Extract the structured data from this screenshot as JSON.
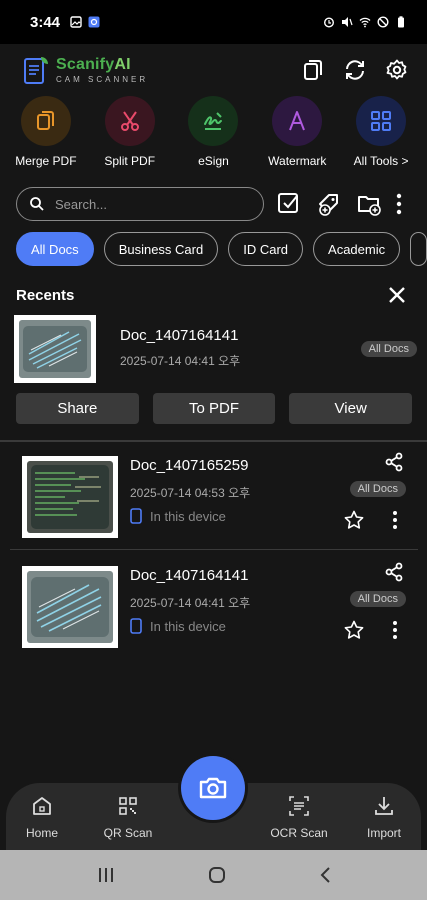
{
  "status_bar": {
    "time": "3:44"
  },
  "app": {
    "name_part1": "Scanify",
    "name_part2": "AI",
    "subtitle": "CAM SCANNER"
  },
  "tools": [
    {
      "label": "Merge PDF",
      "icon": "merge-icon",
      "bg": "#3a2a12",
      "color": "#e8962a"
    },
    {
      "label": "Split PDF",
      "icon": "scissors-icon",
      "bg": "#3a1620",
      "color": "#e84a6a"
    },
    {
      "label": "eSign",
      "icon": "signature-icon",
      "bg": "#15301a",
      "color": "#4ec46a"
    },
    {
      "label": "Watermark",
      "icon": "watermark-icon",
      "bg": "#2d1840",
      "color": "#b05ae0"
    },
    {
      "label": "All Tools >",
      "icon": "grid-icon",
      "bg": "#18224a",
      "color": "#4f7cf6"
    }
  ],
  "search": {
    "placeholder": "Search..."
  },
  "chips": [
    "All Docs",
    "Business Card",
    "ID Card",
    "Academic"
  ],
  "recents": {
    "title": "Recents",
    "name": "Doc_1407164141",
    "date": "2025-07-14  04:41 오후",
    "badge": "All Docs",
    "actions": {
      "share": "Share",
      "to_pdf": "To PDF",
      "view": "View"
    }
  },
  "documents": [
    {
      "name": "Doc_1407165259",
      "date": "2025-07-14  04:53 오후",
      "location": "In this device",
      "badge": "All Docs"
    },
    {
      "name": "Doc_1407164141",
      "date": "2025-07-14  04:41 오후",
      "location": "In this device",
      "badge": "All Docs"
    }
  ],
  "bottom_nav": {
    "home": "Home",
    "qr": "QR Scan",
    "ocr": "OCR Scan",
    "import": "Import"
  },
  "colors": {
    "accent": "#4f7cf6",
    "brand_green": "#4caf50"
  }
}
